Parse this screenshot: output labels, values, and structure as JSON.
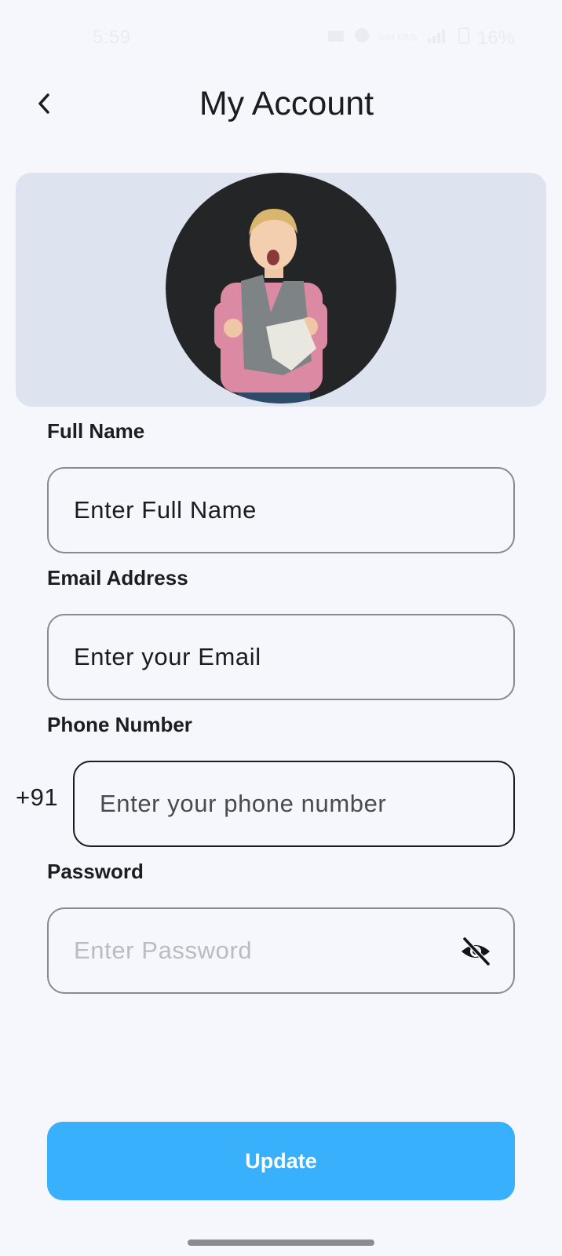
{
  "status_bar": {
    "time": "5:59",
    "net_speed": "0.04 KB/S",
    "battery": "16%"
  },
  "header": {
    "title": "My Account",
    "back_icon": "chevron-left-icon"
  },
  "profile": {
    "avatar_icon": "profile-photo"
  },
  "form": {
    "full_name": {
      "label": "Full Name",
      "placeholder": "Enter Full Name"
    },
    "email": {
      "label": "Email Address",
      "placeholder": "Enter your Email"
    },
    "phone": {
      "label": "Phone Number",
      "country_code": "+91",
      "placeholder": "Enter your phone number"
    },
    "password": {
      "label": "Password",
      "placeholder": "Enter Password",
      "toggle_icon": "eye-off-icon"
    }
  },
  "actions": {
    "update_label": "Update"
  },
  "colors": {
    "background": "#f5f7fc",
    "banner": "#dde3ef",
    "accent": "#38b0fb",
    "text": "#1c1c1f"
  }
}
